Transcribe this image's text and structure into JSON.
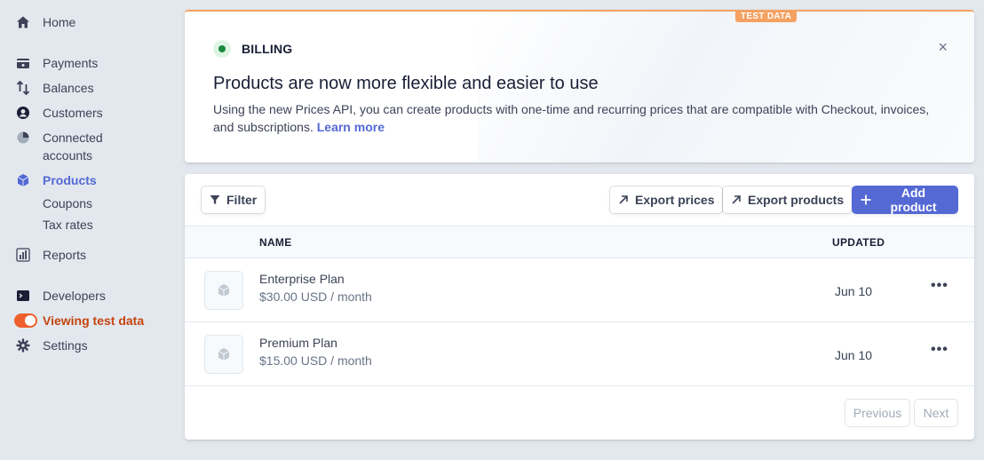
{
  "sidebar": {
    "home": "Home",
    "payments": "Payments",
    "balances": "Balances",
    "customers": "Customers",
    "connected_1": "Connected",
    "connected_2": "accounts",
    "products": "Products",
    "coupons": "Coupons",
    "tax_rates": "Tax rates",
    "reports": "Reports",
    "developers": "Developers",
    "viewing_test_data": "Viewing test data",
    "settings": "Settings"
  },
  "banner": {
    "badge": "TEST DATA",
    "label": "BILLING",
    "close": "×",
    "title": "Products are now more flexible and easier to use",
    "text": "Using the new Prices API, you can create products with one-time and recurring prices that are compatible with Checkout, invoices, and subscriptions.",
    "link": "Learn more"
  },
  "toolbar": {
    "filter": "Filter",
    "export_prices": "Export prices",
    "export_products": "Export products",
    "add_product": "Add product"
  },
  "table": {
    "headers": {
      "name": "NAME",
      "updated": "UPDATED"
    },
    "rows": [
      {
        "name": "Enterprise Plan",
        "price": "$30.00 USD / month",
        "updated": "Jun 10",
        "more": "•••"
      },
      {
        "name": "Premium Plan",
        "price": "$15.00 USD / month",
        "updated": "Jun 10",
        "more": "•••"
      }
    ]
  },
  "pagination": {
    "previous": "Previous",
    "next": "Next"
  },
  "colors": {
    "accent": "#5469d4",
    "test": "#ed5f2c",
    "badge": "#f5a161",
    "billing": "#1a8a3f"
  }
}
